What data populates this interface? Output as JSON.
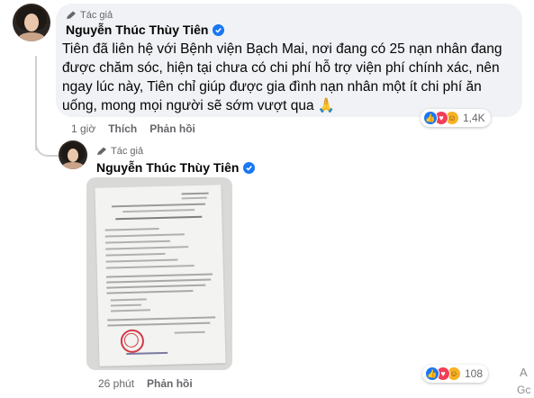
{
  "comment": {
    "author_badge": "Tác giả",
    "author_name": "Nguyễn Thúc Thùy Tiên",
    "text_lines": [
      "Tiên đã liên hệ với Bệnh viện Bạch Mai, nơi đang có 25 nạn nhân đang",
      "được chăm sóc, hiện tại chưa có chi phí hỗ trợ viện phí chính xác, nên",
      "ngay lúc này, Tiên chỉ giúp được gia đình nạn nhân một ít chi phí ăn",
      "uống, mong mọi người sẽ sớm vượt qua 🙏"
    ],
    "time": "1 giờ",
    "like_label": "Thích",
    "reply_label": "Phản hồi",
    "reaction_count": "1,4K",
    "reaction_icons": [
      "like-icon",
      "love-icon",
      "care-icon"
    ]
  },
  "reply": {
    "author_badge": "Tác giả",
    "author_name": "Nguyễn Thúc Thùy Tiên",
    "photo": "document-photo",
    "time": "26 phút",
    "reply_label": "Phản hồi",
    "reaction_count": "108",
    "reaction_icons": [
      "like-icon",
      "love-icon",
      "care-icon"
    ]
  },
  "edge_text": {
    "top": "A",
    "bottom": "Gc"
  },
  "colors": {
    "bubble": "#f0f2f5",
    "verified": "#1877f2",
    "muted": "#65676b",
    "stamp": "#d43a47"
  }
}
